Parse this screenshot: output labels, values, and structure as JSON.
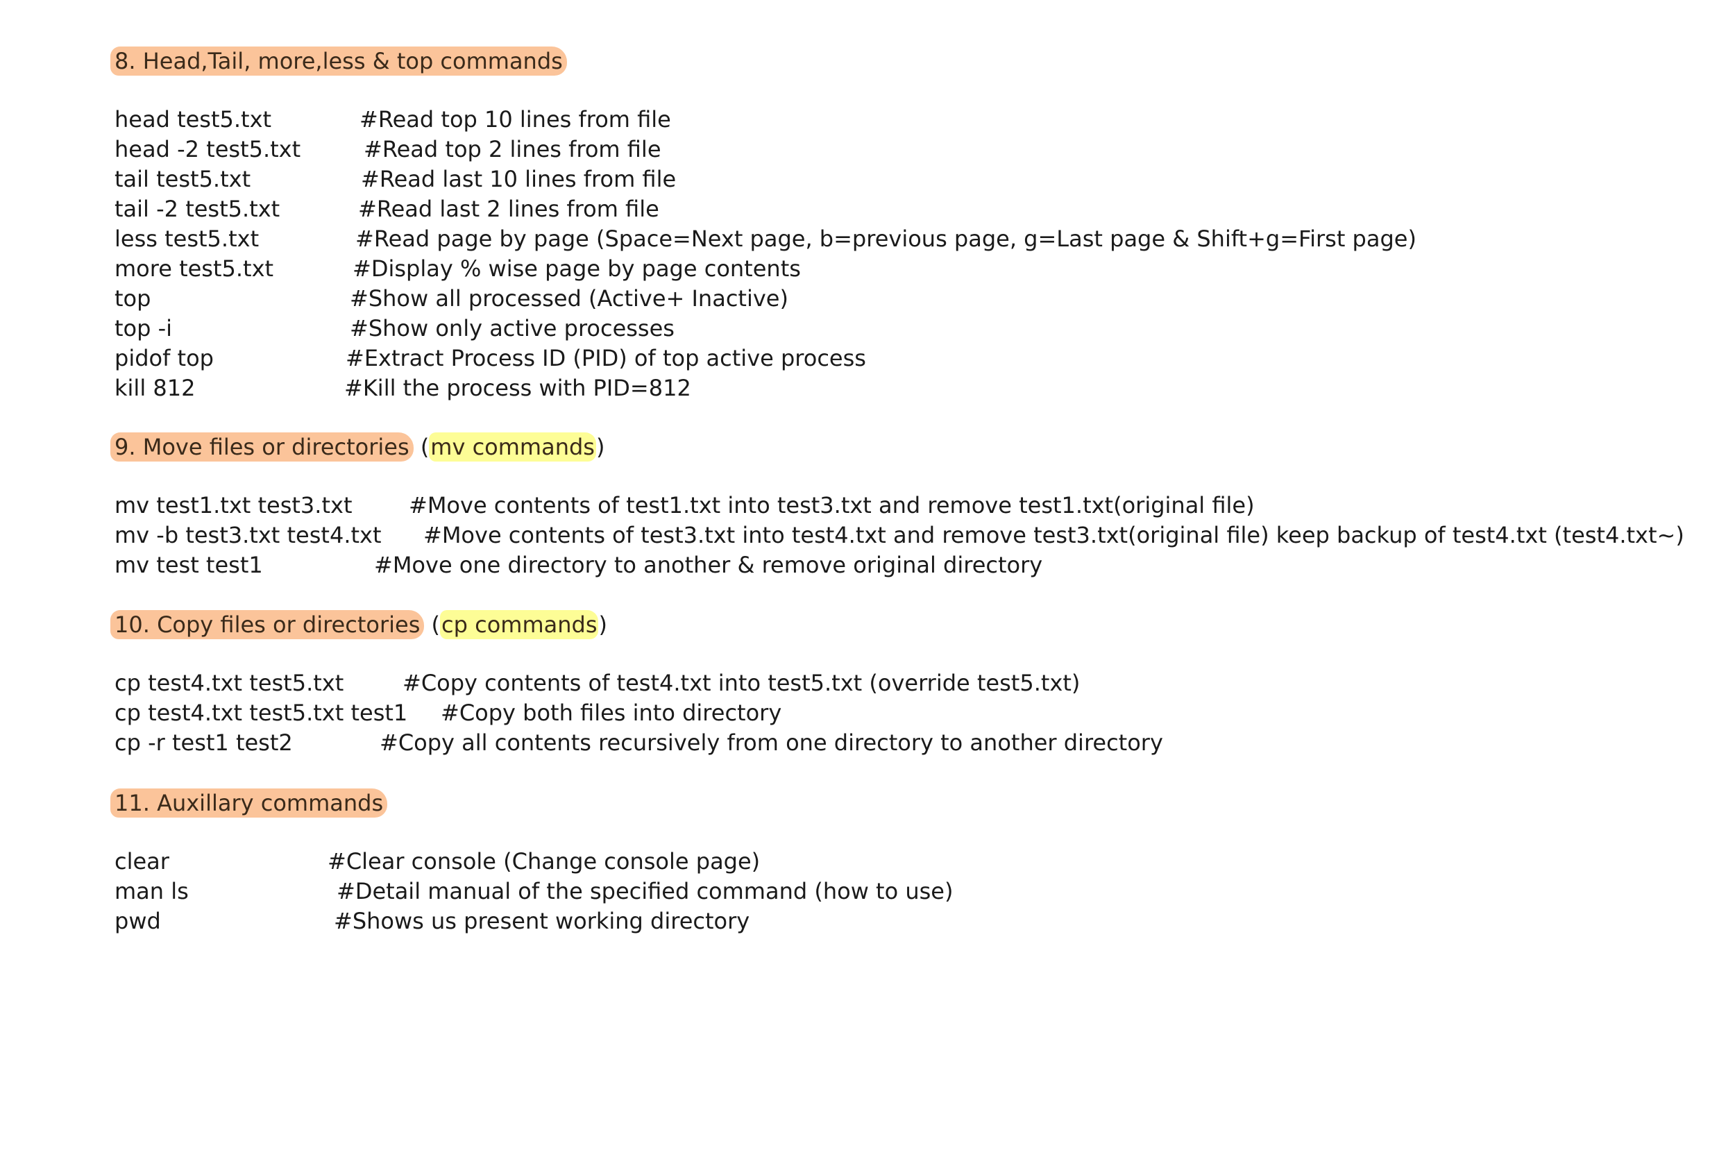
{
  "sections": [
    {
      "heading": "8. Head,Tail, more,less & top commands",
      "rows": [
        {
          "cmd": "head test5.txt",
          "comment": "#Read top 10 lines from file"
        },
        {
          "cmd": "head -2 test5.txt",
          "comment": "#Read top 2 lines from file"
        },
        {
          "cmd": "tail test5.txt",
          "comment": "#Read last 10 lines from file"
        },
        {
          "cmd": "tail -2 test5.txt",
          "comment": "#Read last 2 lines from file"
        },
        {
          "cmd": "less test5.txt",
          "comment": "#Read page by page (Space=Next page, b=previous page, g=Last page & Shift+g=First page)"
        },
        {
          "cmd": "more test5.txt",
          "comment": "#Display % wise page by page contents"
        },
        {
          "cmd": "top",
          "comment": "#Show all processed (Active+ Inactive)"
        },
        {
          "cmd": "top -i",
          "comment": "#Show only active processes"
        },
        {
          "cmd": "pidof top",
          "comment": "#Extract Process ID (PID) of top active process"
        },
        {
          "cmd": "kill 812",
          "comment": "#Kill the process with PID=812"
        }
      ]
    },
    {
      "heading": "9. Move files or directories",
      "heading_extra": "mv commands",
      "rows": [
        {
          "cmd": "mv test1.txt test3.txt",
          "comment": "#Move contents of test1.txt into test3.txt and remove test1.txt(original file)"
        },
        {
          "cmd": "mv -b test3.txt test4.txt",
          "comment": "#Move contents of test3.txt into test4.txt and remove test3.txt(original file) keep backup of test4.txt (test4.txt~)"
        },
        {
          "cmd": "mv test test1",
          "comment": "#Move one directory to another & remove original directory"
        }
      ]
    },
    {
      "heading": "10. Copy files or directories",
      "heading_extra": "cp commands",
      "rows": [
        {
          "cmd": "cp test4.txt test5.txt",
          "comment": "#Copy contents of test4.txt into test5.txt (override test5.txt)"
        },
        {
          "cmd": "cp test4.txt test5.txt test1",
          "comment": "#Copy both files into directory"
        },
        {
          "cmd": "cp -r test1 test2",
          "comment": "#Copy all contents recursively from one directory to another directory"
        }
      ]
    },
    {
      "heading": "11. Auxillary commands",
      "rows": [
        {
          "cmd": "clear",
          "comment": "#Clear console (Change console page)"
        },
        {
          "cmd": "man ls",
          "comment": "#Detail manual of the specified command (how to use)"
        },
        {
          "cmd": "pwd",
          "comment": "#Shows us present working directory"
        }
      ]
    }
  ],
  "colors": {
    "heading_highlight": "#fbc49a",
    "keyword_highlight": "#fdfd96",
    "text": "#1a1a1a"
  }
}
